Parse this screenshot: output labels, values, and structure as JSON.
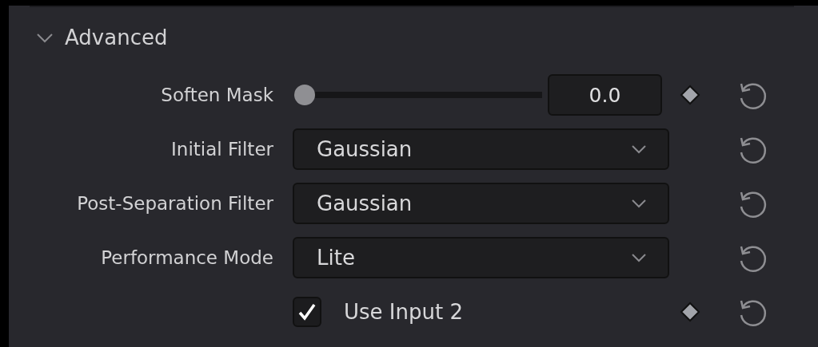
{
  "section": {
    "title": "Advanced",
    "expanded": true
  },
  "rows": [
    {
      "kind": "slider",
      "label": "Soften Mask",
      "level": 0,
      "value": "0.0",
      "keyframe": true
    },
    {
      "kind": "dropdown",
      "label": "Initial Filter",
      "value": "Gaussian",
      "keyframe": false
    },
    {
      "kind": "dropdown",
      "label": "Post-Separation Filter",
      "value": "Gaussian",
      "keyframe": false
    },
    {
      "kind": "dropdown",
      "label": "Performance Mode",
      "value": "Lite",
      "keyframe": false
    },
    {
      "kind": "checkbox",
      "label": "Use Input 2",
      "checked": true,
      "keyframe": true
    }
  ]
}
